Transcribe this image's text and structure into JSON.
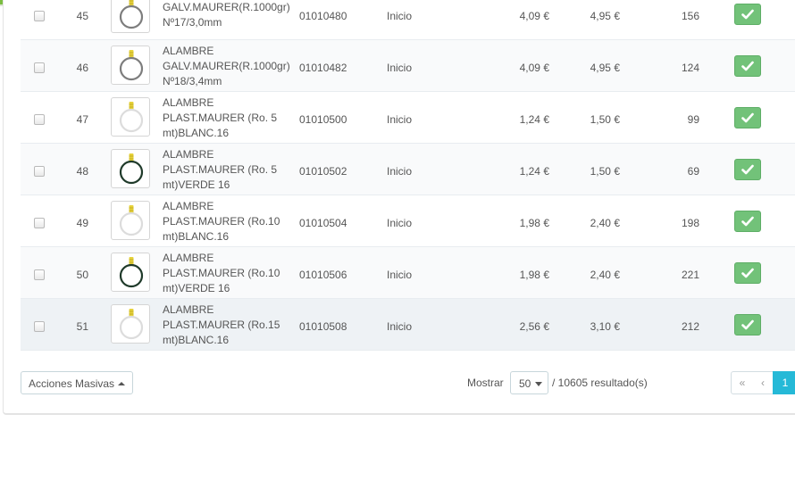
{
  "products": [
    {
      "id": "45",
      "name_lines": [
        "GALV.MAURER(R.1000gr)",
        "Nº17/3,0mm"
      ],
      "reference": "01010480",
      "category": "Inicio",
      "price": "4,09 €",
      "price_tax": "4,95 €",
      "quantity": "156",
      "thumb_color": "#7d7d7d"
    },
    {
      "id": "46",
      "name_lines": [
        "ALAMBRE",
        "GALV.MAURER(R.1000gr)",
        "Nº18/3,4mm"
      ],
      "reference": "01010482",
      "category": "Inicio",
      "price": "4,09 €",
      "price_tax": "4,95 €",
      "quantity": "124",
      "thumb_color": "#7d7d7d"
    },
    {
      "id": "47",
      "name_lines": [
        "ALAMBRE",
        "PLAST.MAURER (Ro. 5",
        "mt)BLANC.16"
      ],
      "reference": "01010500",
      "category": "Inicio",
      "price": "1,24 €",
      "price_tax": "1,50 €",
      "quantity": "99",
      "thumb_color": "#dcdcdc"
    },
    {
      "id": "48",
      "name_lines": [
        "ALAMBRE",
        "PLAST.MAURER (Ro. 5",
        "mt)VERDE 16"
      ],
      "reference": "01010502",
      "category": "Inicio",
      "price": "1,24 €",
      "price_tax": "1,50 €",
      "quantity": "69",
      "thumb_color": "#1f3a2a"
    },
    {
      "id": "49",
      "name_lines": [
        "ALAMBRE",
        "PLAST.MAURER (Ro.10",
        "mt)BLANC.16"
      ],
      "reference": "01010504",
      "category": "Inicio",
      "price": "1,98 €",
      "price_tax": "2,40 €",
      "quantity": "198",
      "thumb_color": "#dcdcdc"
    },
    {
      "id": "50",
      "name_lines": [
        "ALAMBRE",
        "PLAST.MAURER (Ro.10",
        "mt)VERDE 16"
      ],
      "reference": "01010506",
      "category": "Inicio",
      "price": "1,98 €",
      "price_tax": "2,40 €",
      "quantity": "221",
      "thumb_color": "#1f3a2a"
    },
    {
      "id": "51",
      "name_lines": [
        "ALAMBRE",
        "PLAST.MAURER (Ro.15",
        "mt)BLANC.16"
      ],
      "reference": "01010508",
      "category": "Inicio",
      "price": "2,56 €",
      "price_tax": "3,10 €",
      "quantity": "212",
      "thumb_color": "#dcdcdc"
    }
  ],
  "footer": {
    "bulk_actions_label": "Acciones Masivas",
    "show_label": "Mostrar",
    "page_size": "50",
    "results_text": "/ 10605 resultado(s)",
    "pagination": {
      "first_icon": "«",
      "prev_icon": "‹",
      "current_page": "1"
    }
  },
  "colors": {
    "accent": "#25b9d7",
    "status_enabled": "#72c279",
    "top_bar": "#7bbd41"
  }
}
